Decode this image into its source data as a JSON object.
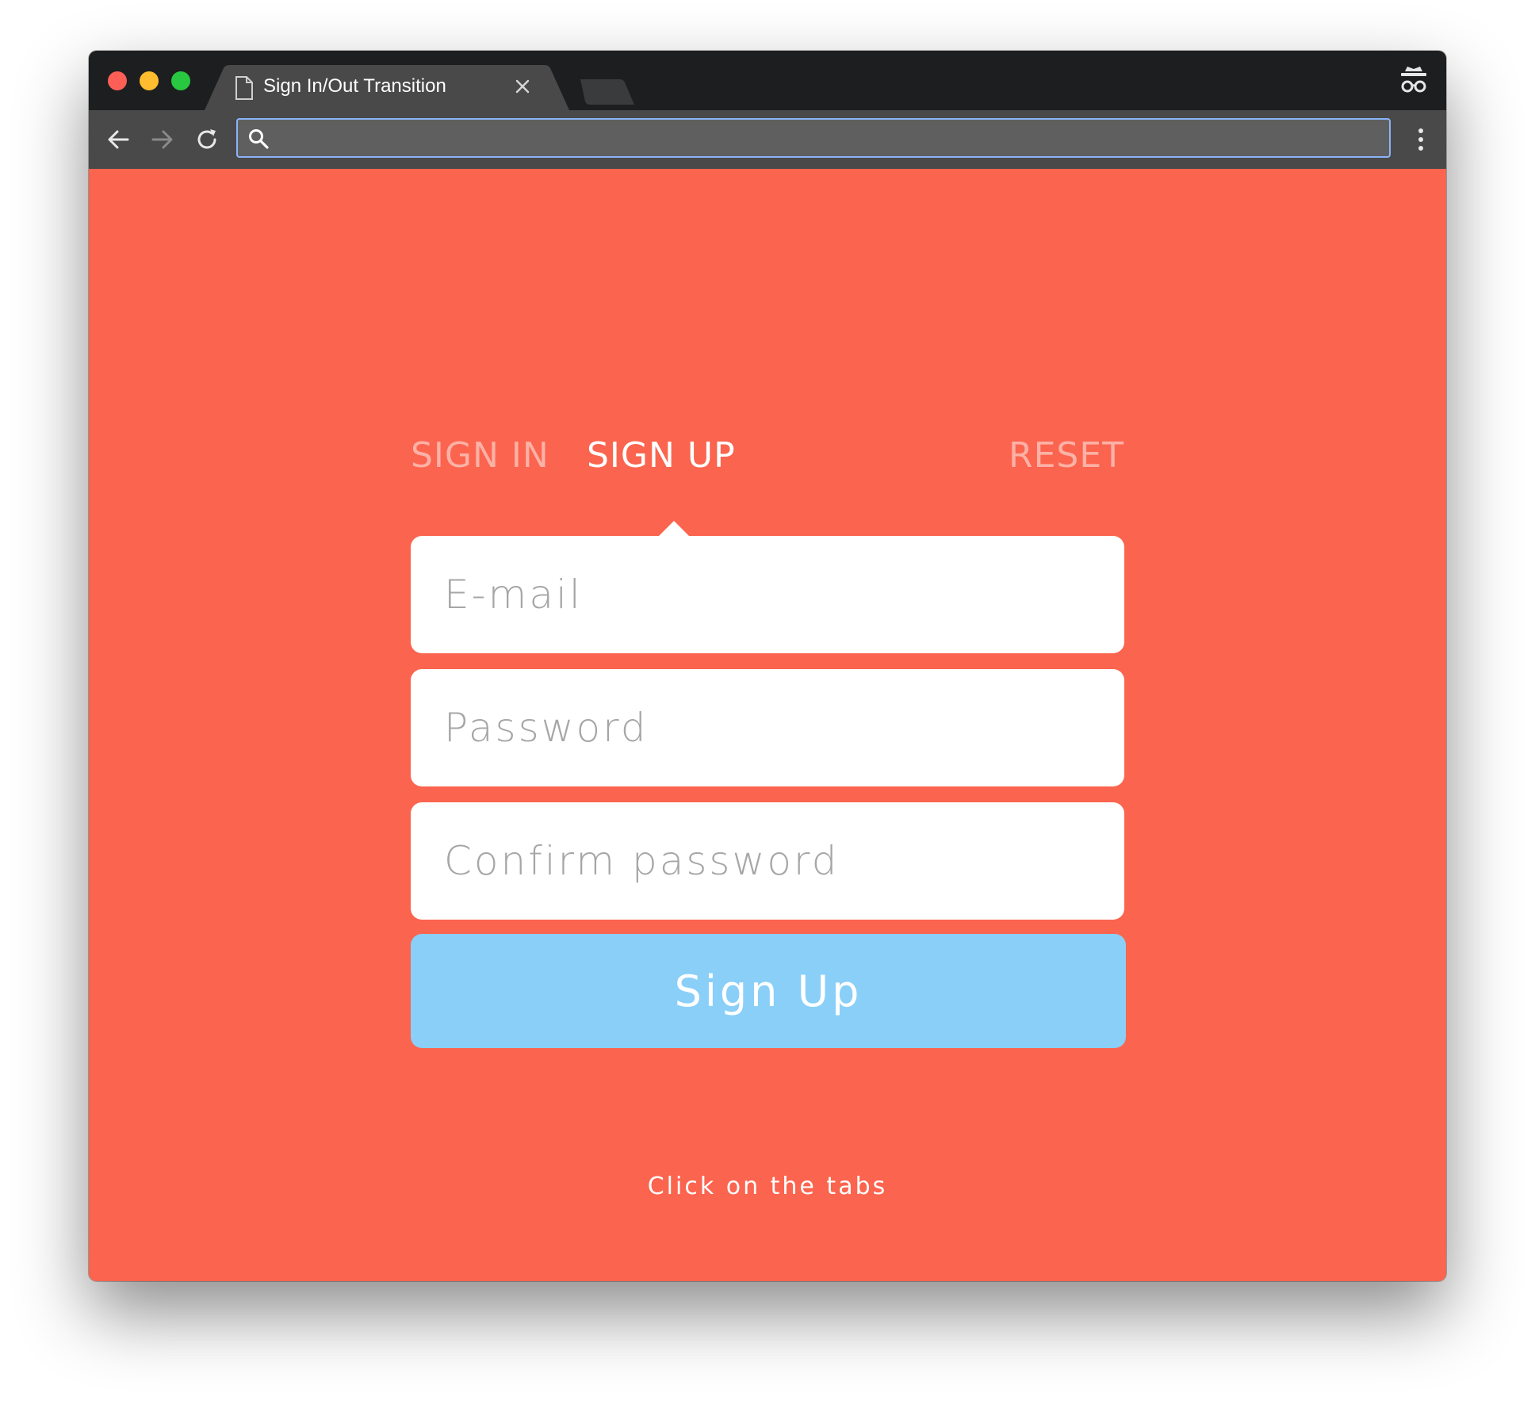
{
  "browser": {
    "tab_title": "Sign In/Out Transition",
    "address_value": "",
    "icons": {
      "close": "close-icon",
      "back": "back-arrow-icon",
      "forward": "forward-arrow-icon",
      "reload": "reload-icon",
      "search": "search-icon",
      "menu": "kebab-menu-icon",
      "incognito": "incognito-icon",
      "page": "page-icon"
    }
  },
  "form": {
    "tabs": {
      "sign_in": "SIGN IN",
      "sign_up": "SIGN UP",
      "reset": "RESET"
    },
    "active_tab": "sign_up",
    "fields": {
      "email_placeholder": "E-mail",
      "password_placeholder": "Password",
      "confirm_placeholder": "Confirm password"
    },
    "submit_label": "Sign Up",
    "hint": "Click on the tabs"
  },
  "colors": {
    "page_background": "#fb644e",
    "active_tab_text": "#ffffff",
    "inactive_tab_text": "#fcb1a6",
    "submit_background": "#8acff8",
    "titlebar": "#1d1e20",
    "toolbar": "#494949"
  }
}
